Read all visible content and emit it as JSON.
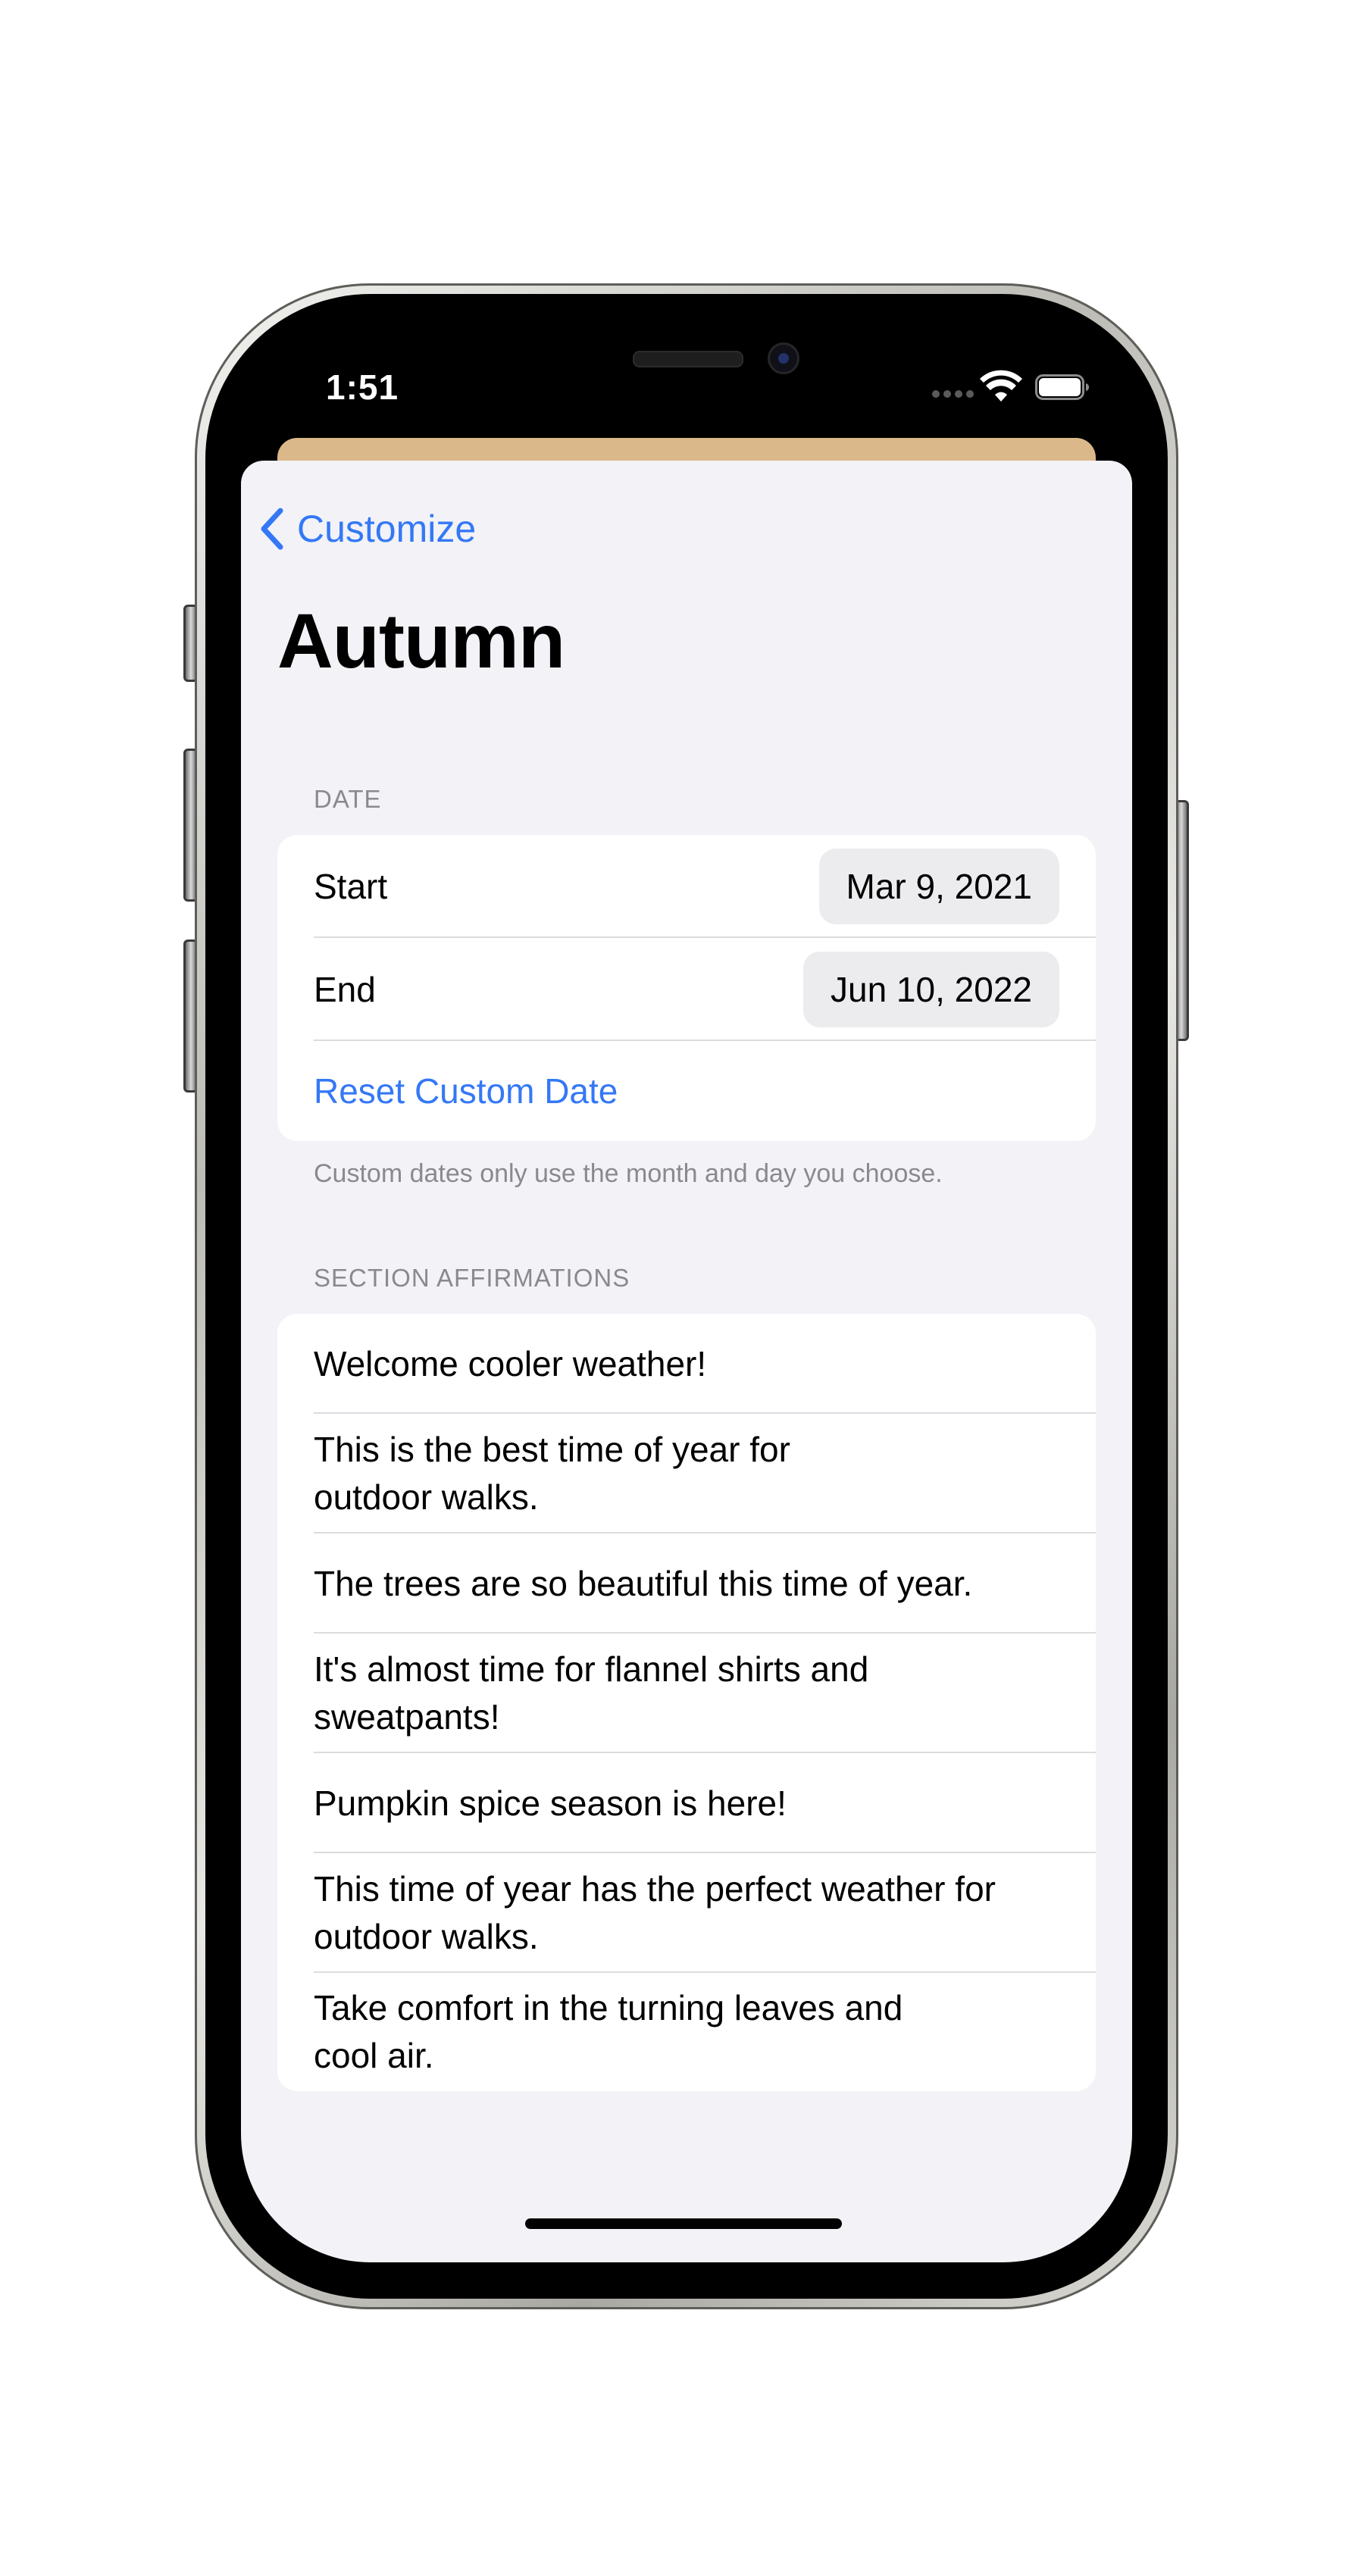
{
  "status_bar": {
    "time": "1:51"
  },
  "navigation": {
    "back_label": "Customize",
    "title": "Autumn"
  },
  "date_section": {
    "header": "DATE",
    "start_label": "Start",
    "start_value": "Mar 9, 2021",
    "end_label": "End",
    "end_value": "Jun 10, 2022",
    "reset_label": "Reset Custom Date",
    "footer": "Custom dates only use the month and day you choose."
  },
  "affirmations_section": {
    "header": "SECTION AFFIRMATIONS",
    "items": [
      {
        "text": "Welcome cooler weather!"
      },
      {
        "text": "This is the best time of year for\noutdoor walks."
      },
      {
        "text": "The trees are so beautiful this time of year."
      },
      {
        "text": "It's almost time for flannel shirts and\nsweatpants!"
      },
      {
        "text": "Pumpkin spice season is here!"
      },
      {
        "text": "This time of year has the perfect weather for\noutdoor walks."
      },
      {
        "text": "Take comfort in the turning leaves and\ncool air."
      }
    ]
  },
  "colors": {
    "accent": "#3478f6",
    "sheet_background": "#f2f2f7",
    "behind_sheet": "#dbb88a"
  }
}
